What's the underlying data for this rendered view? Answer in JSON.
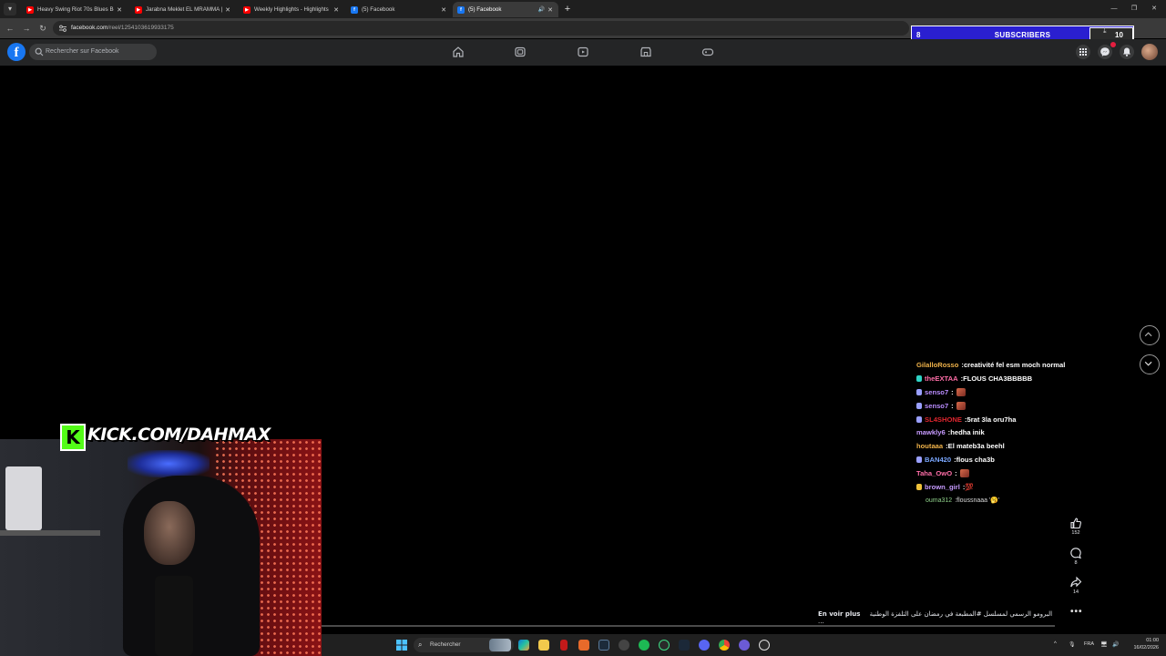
{
  "browser": {
    "tabs": [
      {
        "title": "Heavy Swing Riot 70s Blues Bo",
        "favicon": "youtube-icon",
        "active": false
      },
      {
        "title": "Jarabna Meklet EL MRAMMA | E",
        "favicon": "youtube-icon",
        "active": false
      },
      {
        "title": "Weekly Highlights - Highlights",
        "favicon": "youtube-icon",
        "active": false
      },
      {
        "title": "(5) Facebook",
        "favicon": "facebook-icon",
        "active": false
      },
      {
        "title": "(5) Facebook",
        "favicon": "facebook-icon",
        "active": true,
        "audio": true
      }
    ],
    "url_host": "facebook.com",
    "url_path": "/reel/1254103619933175"
  },
  "subscribers": {
    "left_value": "8",
    "label": "SUBSCRIBERS",
    "right_value": "10"
  },
  "facebook": {
    "search_placeholder": "Rechercher sur Facebook",
    "brand_color": "#1877f2"
  },
  "overlay": {
    "kick_text": "KICK.COM/DAHMAX",
    "kick_color": "#53fc18"
  },
  "chat": [
    {
      "user": "GilalloRosso",
      "color": "#f0b34a",
      "badge": null,
      "message": "creativité fel esm moch normal"
    },
    {
      "user": "theEXTAA",
      "color": "#ff6ea8",
      "badge": "#2fd3c5",
      "message": "FLOUS CHA3BBBBB"
    },
    {
      "user": "senso7",
      "color": "#b98cff",
      "badge": "#9aa0ff",
      "message": "",
      "emote": true
    },
    {
      "user": "senso7",
      "color": "#b98cff",
      "badge": "#9aa0ff",
      "message": "",
      "emote": true
    },
    {
      "user": "SL4SHONE",
      "color": "#e0262f",
      "badge": "#9aa0ff",
      "message": "5rat 3la oru7ha"
    },
    {
      "user": "mawkly6",
      "color": "#c79bff",
      "badge": null,
      "message": "hedha inik"
    },
    {
      "user": "houtaaa",
      "color": "#f0b34a",
      "badge": null,
      "message": "El mateb3a beehl"
    },
    {
      "user": "BAN420",
      "color": "#7aa7ff",
      "badge": "#9aa0ff",
      "message": "flous cha3b"
    },
    {
      "user": "Taha_OwO",
      "color": "#ff6ea8",
      "badge": null,
      "message": "",
      "emote": true
    },
    {
      "user": "brown_girl",
      "color": "#c79bff",
      "badge": "#f0c23a",
      "message": "💯"
    },
    {
      "user": "ouma312",
      "color": "#8fd08a",
      "badge": null,
      "message": "floussnaaa '🥱'",
      "small": true
    }
  ],
  "reel": {
    "likes": "152",
    "comments": "8",
    "shares": "14",
    "see_more": "En voir plus",
    "caption": "البرومو الرسمي لمسلسل #المطبعة في رمضان على التلفزة الوطنية ...",
    "more_label": "•••"
  },
  "taskbar": {
    "search_placeholder": "Rechercher",
    "language": "FRA",
    "time": "01:00",
    "date": "16/02/2026"
  }
}
